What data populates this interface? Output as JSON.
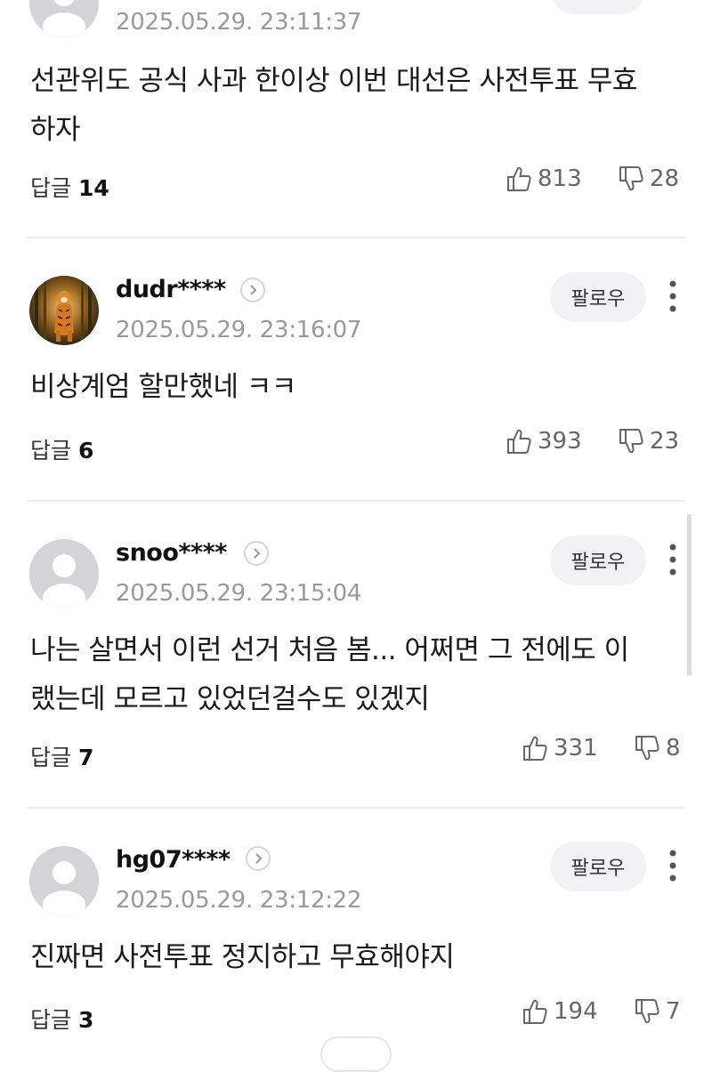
{
  "follow_label": "팔로우",
  "reply_label": "답글",
  "comments": [
    {
      "username": "",
      "timestamp": "2025.05.29. 23:11:37",
      "text": "선관위도 공식 사과 한이상 이번 대선은 사전투표 무효하자",
      "replies": "14",
      "likes": "813",
      "dislikes": "28",
      "avatar": "default-avatar"
    },
    {
      "username": "dudr****",
      "timestamp": "2025.05.29. 23:16:07",
      "text": "비상계엄 할만했네 ㅋㅋ",
      "replies": "6",
      "likes": "393",
      "dislikes": "23",
      "avatar": "tiger-avatar"
    },
    {
      "username": "snoo****",
      "timestamp": "2025.05.29. 23:15:04",
      "text": "나는 살면서 이런 선거 처음 봄... 어쩌면 그 전에도 이랬는데 모르고 있었던걸수도 있겠지",
      "replies": "7",
      "likes": "331",
      "dislikes": "8",
      "avatar": "default-avatar"
    },
    {
      "username": "hg07****",
      "timestamp": "2025.05.29. 23:12:22",
      "text": "진짜면 사전투표 정지하고 무효해야지",
      "replies": "3",
      "likes": "194",
      "dislikes": "7",
      "avatar": "default-avatar"
    }
  ],
  "colors": {
    "background": "#ffffff",
    "timestamp": "#999999",
    "follow_bg": "#f2f2f4",
    "divider": "#ececec"
  }
}
